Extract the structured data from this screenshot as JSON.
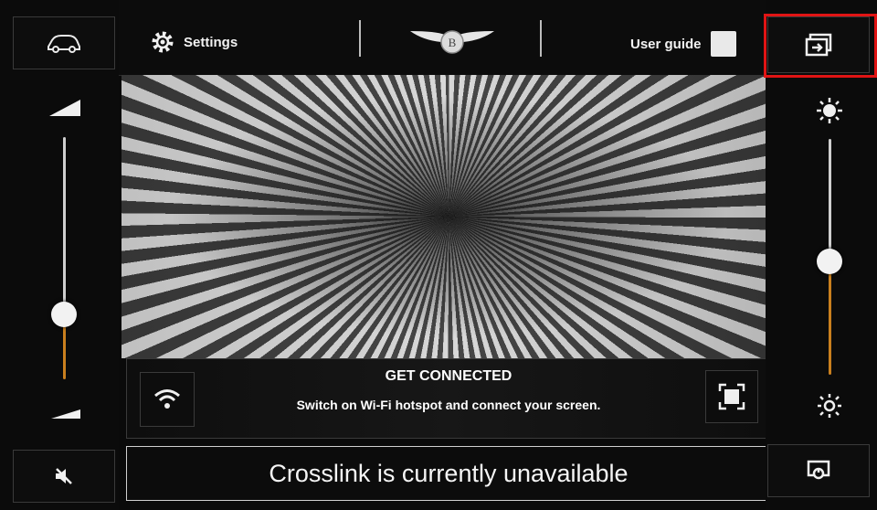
{
  "topbar": {
    "settings_label": "Settings",
    "user_guide_label": "User guide"
  },
  "connect_panel": {
    "title": "GET CONNECTED",
    "subtitle": "Switch on Wi-Fi hotspot and connect your screen."
  },
  "status": {
    "message": "Crosslink is currently unavailable"
  },
  "volume_slider": {
    "level": 0.38,
    "accent": "#c97f1e"
  },
  "brightness_slider": {
    "level": 0.52
  },
  "icons": {
    "car_top_left": "car-icon",
    "mute": "mute-icon",
    "settings": "gear-icon",
    "logo": "winged-logo",
    "input_switch": "input-switch-icon",
    "brightness_high": "sun-icon",
    "brightness_low": "sun-small-icon",
    "wifi": "wifi-icon",
    "fullscreen": "fullscreen-icon",
    "display_off": "display-icon"
  },
  "colors": {
    "highlight": "#e01414"
  }
}
